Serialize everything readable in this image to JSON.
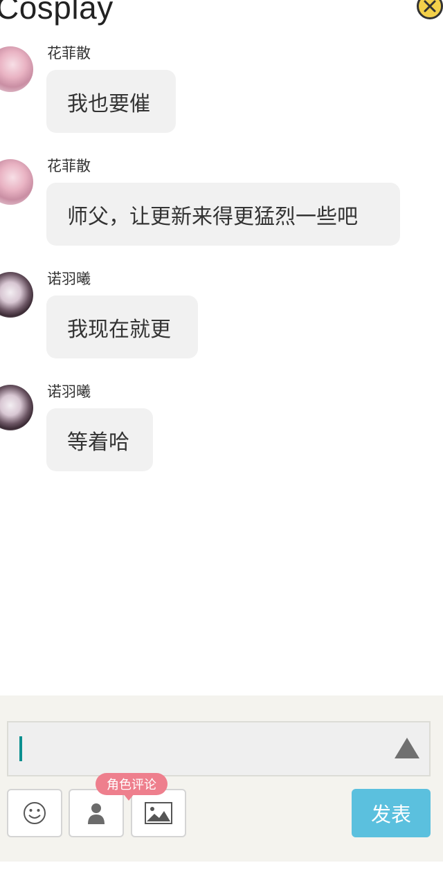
{
  "header": {
    "title": "Cosplay",
    "close_icon": "close-icon"
  },
  "messages": [
    {
      "user": "花菲散",
      "text": "我也要催"
    },
    {
      "user": "花菲散",
      "text": "师父，让更新来得更猛烈一些吧"
    },
    {
      "user": "诺羽曦",
      "text": "我现在就更"
    },
    {
      "user": "诺羽曦",
      "text": "等着哈"
    }
  ],
  "composer": {
    "input_value": "",
    "role_badge": "角色评论",
    "send_label": "发表",
    "icons": [
      "emoji-icon",
      "person-icon",
      "image-icon",
      "expand-up-icon"
    ]
  },
  "colors": {
    "bubble": "#f1f1f1",
    "send_button": "#5bc0de",
    "role_badge": "#ee7f8d",
    "composer_bg": "#f4f3ee"
  }
}
